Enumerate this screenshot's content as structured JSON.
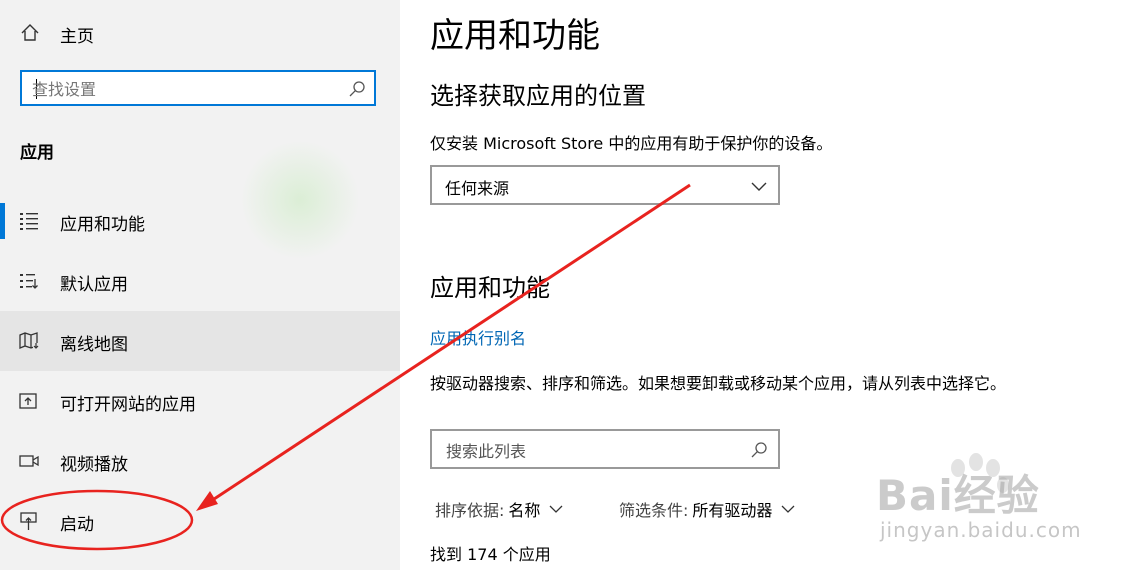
{
  "sidebar": {
    "home_label": "主页",
    "search_placeholder": "查找设置",
    "section_title": "应用",
    "items": [
      {
        "label": "应用和功能",
        "icon": "apps-list-icon"
      },
      {
        "label": "默认应用",
        "icon": "default-apps-icon"
      },
      {
        "label": "离线地图",
        "icon": "offline-map-icon"
      },
      {
        "label": "可打开网站的应用",
        "icon": "apps-for-websites-icon"
      },
      {
        "label": "视频播放",
        "icon": "video-playback-icon"
      },
      {
        "label": "启动",
        "icon": "startup-icon"
      }
    ]
  },
  "main": {
    "title": "应用和功能",
    "choose_location": {
      "heading": "选择获取应用的位置",
      "description": "仅安装 Microsoft Store 中的应用有助于保护你的设备。",
      "dropdown_value": "任何来源"
    },
    "apps_features": {
      "heading": "应用和功能",
      "alias_link": "应用执行别名",
      "description": "按驱动器搜索、排序和筛选。如果想要卸载或移动某个应用，请从列表中选择它。",
      "search_placeholder": "搜索此列表",
      "sort_label": "排序依据:",
      "sort_value": "名称",
      "filter_label": "筛选条件:",
      "filter_value": "所有驱动器",
      "count_text": "找到 174 个应用"
    }
  },
  "watermark": {
    "brand": "Bai经验",
    "url": "jingyan.baidu.com"
  },
  "colors": {
    "accent": "#0078d7",
    "link": "#0066b4",
    "annotation": "#e8231f",
    "sidebar_bg": "#f2f2f2"
  }
}
